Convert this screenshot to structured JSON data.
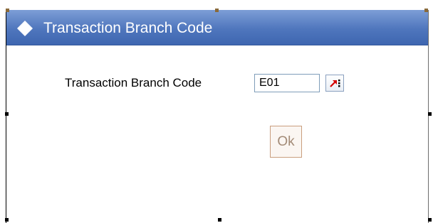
{
  "window": {
    "title": "Transaction Branch Code",
    "title_icon": "diamond-icon",
    "colors": {
      "titlebar": "#4f76bd",
      "title_text": "#ffffff",
      "input_border": "#7f9db9",
      "ok_border": "#c99e7e",
      "ok_text": "#a38b77"
    }
  },
  "form": {
    "branch_label": "Transaction Branch Code",
    "branch_value": "E01",
    "lov_icon": "list-of-values-icon"
  },
  "actions": {
    "ok_label": "Ok"
  }
}
